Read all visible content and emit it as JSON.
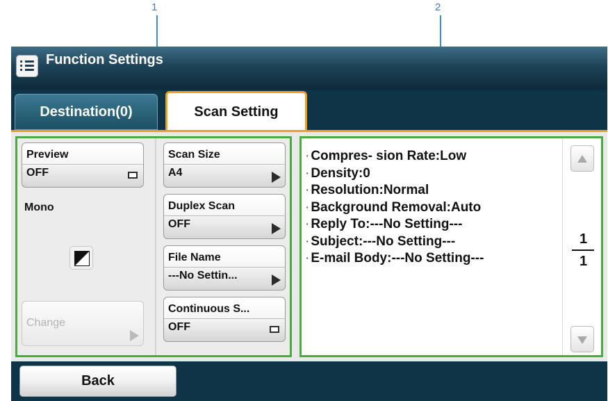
{
  "callouts": [
    "1",
    "2"
  ],
  "title_bar": {
    "title": "Function Settings",
    "menu_icon": "list-icon"
  },
  "tabs": [
    {
      "label": "Destination(0)",
      "selected": false
    },
    {
      "label": "Scan Setting",
      "selected": true
    }
  ],
  "left_panel": {
    "preview": {
      "label": "Preview",
      "value": "OFF"
    },
    "color_mode_label": "Mono",
    "color_toggle_icon": "mono-color-icon",
    "change_button": {
      "label": "Change",
      "enabled": false
    },
    "scan_size": {
      "label": "Scan Size",
      "value": "A4"
    },
    "duplex_scan": {
      "label": "Duplex Scan",
      "value": "OFF"
    },
    "file_name": {
      "label": "File Name",
      "value": "---No Settin..."
    },
    "continuous_scan": {
      "label": "Continuous S...",
      "value": "OFF"
    }
  },
  "right_panel": {
    "settings": [
      "Compres- sion Rate:Low",
      "Density:0",
      "Resolution:Normal",
      "Background Removal:Auto",
      "Reply To:---No Setting---",
      "Subject:---No Setting---",
      "E-mail Body:---No Setting---"
    ],
    "page_current": "1",
    "page_total": "1"
  },
  "bottom_bar": {
    "back_label": "Back"
  },
  "colors": {
    "highlight_green": "#4aab44",
    "tab_accent_orange": "#f0a020",
    "bar_dark_teal": "#0f3447",
    "callout_blue": "#3a7fc0"
  }
}
